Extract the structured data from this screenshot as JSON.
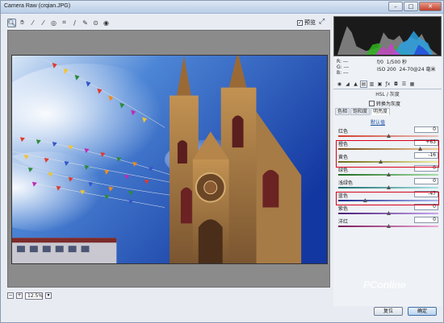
{
  "window": {
    "title": "Camera Raw (crqian.JPG)",
    "minimize": "–",
    "maximize": "□",
    "close": "✕"
  },
  "toolbar": {
    "tools": [
      "zoom-icon",
      "hand-icon",
      "eyedropper-icon",
      "color-sampler-icon",
      "targeted-adjust-icon",
      "crop-icon",
      "straighten-icon",
      "brush-icon",
      "spot-removal-icon",
      "redeye-icon"
    ],
    "preview_label": "预览",
    "preview_checked": true
  },
  "readout": {
    "r": "R:",
    "g": "G:",
    "b": "B:",
    "r_val": "---",
    "g_val": "---",
    "b_val": "---",
    "aperture": "f/0",
    "shutter": "1/500 秒",
    "iso": "ISO 200",
    "lens": "24-70@24 毫米"
  },
  "panel": {
    "section_title": "HSL / 灰度",
    "convert_gray_label": "转换为灰度",
    "subtabs": [
      "色相",
      "饱和度",
      "明亮度"
    ],
    "active_subtab": 2,
    "default_label": "默认值",
    "sliders": [
      {
        "label": "红色",
        "value": "0",
        "pos": 0.5,
        "from": "#d23b2a",
        "to": "#e9c4be"
      },
      {
        "label": "橙色",
        "value": "+63",
        "pos": 0.815,
        "from": "#7a4a1a",
        "to": "#f4c99a"
      },
      {
        "label": "黄色",
        "value": "-16",
        "pos": 0.42,
        "from": "#6e6a18",
        "to": "#f1ee9a"
      },
      {
        "label": "绿色",
        "value": "0",
        "pos": 0.5,
        "from": "#1e6a1e",
        "to": "#a8e0a8"
      },
      {
        "label": "浅绿色",
        "value": "0",
        "pos": 0.5,
        "from": "#176a6a",
        "to": "#a9e6e6"
      },
      {
        "label": "蓝色",
        "value": "-47",
        "pos": 0.265,
        "from": "#1a2a8a",
        "to": "#a9b8f0"
      },
      {
        "label": "紫色",
        "value": "0",
        "pos": 0.5,
        "from": "#4a1a7a",
        "to": "#caa9ee"
      },
      {
        "label": "洋红",
        "value": "0",
        "pos": 0.5,
        "from": "#7a1a5a",
        "to": "#eea9d8"
      }
    ]
  },
  "statusbar": {
    "zoom": "12.5%"
  },
  "footer": {
    "reset": "复位",
    "ok": "确定"
  },
  "watermark": "PConline",
  "colors": {
    "highlight": "#d9001b",
    "sky": "#1d4fb0",
    "stone": "#b88a4e"
  }
}
